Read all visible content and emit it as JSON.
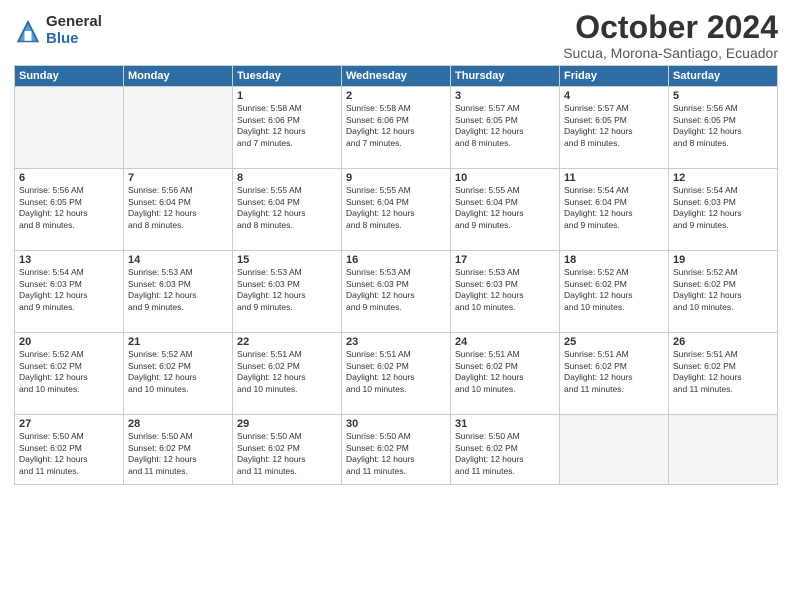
{
  "logo": {
    "general": "General",
    "blue": "Blue"
  },
  "title": "October 2024",
  "subtitle": "Sucua, Morona-Santiago, Ecuador",
  "days_header": [
    "Sunday",
    "Monday",
    "Tuesday",
    "Wednesday",
    "Thursday",
    "Friday",
    "Saturday"
  ],
  "weeks": [
    [
      {
        "day": "",
        "info": ""
      },
      {
        "day": "",
        "info": ""
      },
      {
        "day": "1",
        "info": "Sunrise: 5:58 AM\nSunset: 6:06 PM\nDaylight: 12 hours\nand 7 minutes."
      },
      {
        "day": "2",
        "info": "Sunrise: 5:58 AM\nSunset: 6:06 PM\nDaylight: 12 hours\nand 7 minutes."
      },
      {
        "day": "3",
        "info": "Sunrise: 5:57 AM\nSunset: 6:05 PM\nDaylight: 12 hours\nand 8 minutes."
      },
      {
        "day": "4",
        "info": "Sunrise: 5:57 AM\nSunset: 6:05 PM\nDaylight: 12 hours\nand 8 minutes."
      },
      {
        "day": "5",
        "info": "Sunrise: 5:56 AM\nSunset: 6:05 PM\nDaylight: 12 hours\nand 8 minutes."
      }
    ],
    [
      {
        "day": "6",
        "info": "Sunrise: 5:56 AM\nSunset: 6:05 PM\nDaylight: 12 hours\nand 8 minutes."
      },
      {
        "day": "7",
        "info": "Sunrise: 5:56 AM\nSunset: 6:04 PM\nDaylight: 12 hours\nand 8 minutes."
      },
      {
        "day": "8",
        "info": "Sunrise: 5:55 AM\nSunset: 6:04 PM\nDaylight: 12 hours\nand 8 minutes."
      },
      {
        "day": "9",
        "info": "Sunrise: 5:55 AM\nSunset: 6:04 PM\nDaylight: 12 hours\nand 8 minutes."
      },
      {
        "day": "10",
        "info": "Sunrise: 5:55 AM\nSunset: 6:04 PM\nDaylight: 12 hours\nand 9 minutes."
      },
      {
        "day": "11",
        "info": "Sunrise: 5:54 AM\nSunset: 6:04 PM\nDaylight: 12 hours\nand 9 minutes."
      },
      {
        "day": "12",
        "info": "Sunrise: 5:54 AM\nSunset: 6:03 PM\nDaylight: 12 hours\nand 9 minutes."
      }
    ],
    [
      {
        "day": "13",
        "info": "Sunrise: 5:54 AM\nSunset: 6:03 PM\nDaylight: 12 hours\nand 9 minutes."
      },
      {
        "day": "14",
        "info": "Sunrise: 5:53 AM\nSunset: 6:03 PM\nDaylight: 12 hours\nand 9 minutes."
      },
      {
        "day": "15",
        "info": "Sunrise: 5:53 AM\nSunset: 6:03 PM\nDaylight: 12 hours\nand 9 minutes."
      },
      {
        "day": "16",
        "info": "Sunrise: 5:53 AM\nSunset: 6:03 PM\nDaylight: 12 hours\nand 9 minutes."
      },
      {
        "day": "17",
        "info": "Sunrise: 5:53 AM\nSunset: 6:03 PM\nDaylight: 12 hours\nand 10 minutes."
      },
      {
        "day": "18",
        "info": "Sunrise: 5:52 AM\nSunset: 6:02 PM\nDaylight: 12 hours\nand 10 minutes."
      },
      {
        "day": "19",
        "info": "Sunrise: 5:52 AM\nSunset: 6:02 PM\nDaylight: 12 hours\nand 10 minutes."
      }
    ],
    [
      {
        "day": "20",
        "info": "Sunrise: 5:52 AM\nSunset: 6:02 PM\nDaylight: 12 hours\nand 10 minutes."
      },
      {
        "day": "21",
        "info": "Sunrise: 5:52 AM\nSunset: 6:02 PM\nDaylight: 12 hours\nand 10 minutes."
      },
      {
        "day": "22",
        "info": "Sunrise: 5:51 AM\nSunset: 6:02 PM\nDaylight: 12 hours\nand 10 minutes."
      },
      {
        "day": "23",
        "info": "Sunrise: 5:51 AM\nSunset: 6:02 PM\nDaylight: 12 hours\nand 10 minutes."
      },
      {
        "day": "24",
        "info": "Sunrise: 5:51 AM\nSunset: 6:02 PM\nDaylight: 12 hours\nand 10 minutes."
      },
      {
        "day": "25",
        "info": "Sunrise: 5:51 AM\nSunset: 6:02 PM\nDaylight: 12 hours\nand 11 minutes."
      },
      {
        "day": "26",
        "info": "Sunrise: 5:51 AM\nSunset: 6:02 PM\nDaylight: 12 hours\nand 11 minutes."
      }
    ],
    [
      {
        "day": "27",
        "info": "Sunrise: 5:50 AM\nSunset: 6:02 PM\nDaylight: 12 hours\nand 11 minutes."
      },
      {
        "day": "28",
        "info": "Sunrise: 5:50 AM\nSunset: 6:02 PM\nDaylight: 12 hours\nand 11 minutes."
      },
      {
        "day": "29",
        "info": "Sunrise: 5:50 AM\nSunset: 6:02 PM\nDaylight: 12 hours\nand 11 minutes."
      },
      {
        "day": "30",
        "info": "Sunrise: 5:50 AM\nSunset: 6:02 PM\nDaylight: 12 hours\nand 11 minutes."
      },
      {
        "day": "31",
        "info": "Sunrise: 5:50 AM\nSunset: 6:02 PM\nDaylight: 12 hours\nand 11 minutes."
      },
      {
        "day": "",
        "info": ""
      },
      {
        "day": "",
        "info": ""
      }
    ]
  ]
}
